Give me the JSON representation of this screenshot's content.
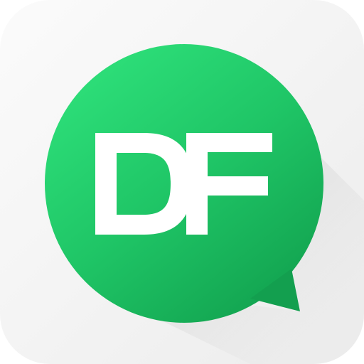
{
  "icon": {
    "logo_text": "DF",
    "logo_description": "chat-bubble-logo",
    "colors": {
      "tile_light": "#fbfbfb",
      "tile_dark": "#ececec",
      "bubble_light": "#2ee07a",
      "bubble_mid": "#1fc566",
      "bubble_dark": "#12a24f",
      "letter": "#ffffff",
      "shadow": "#c9c9c9"
    }
  }
}
